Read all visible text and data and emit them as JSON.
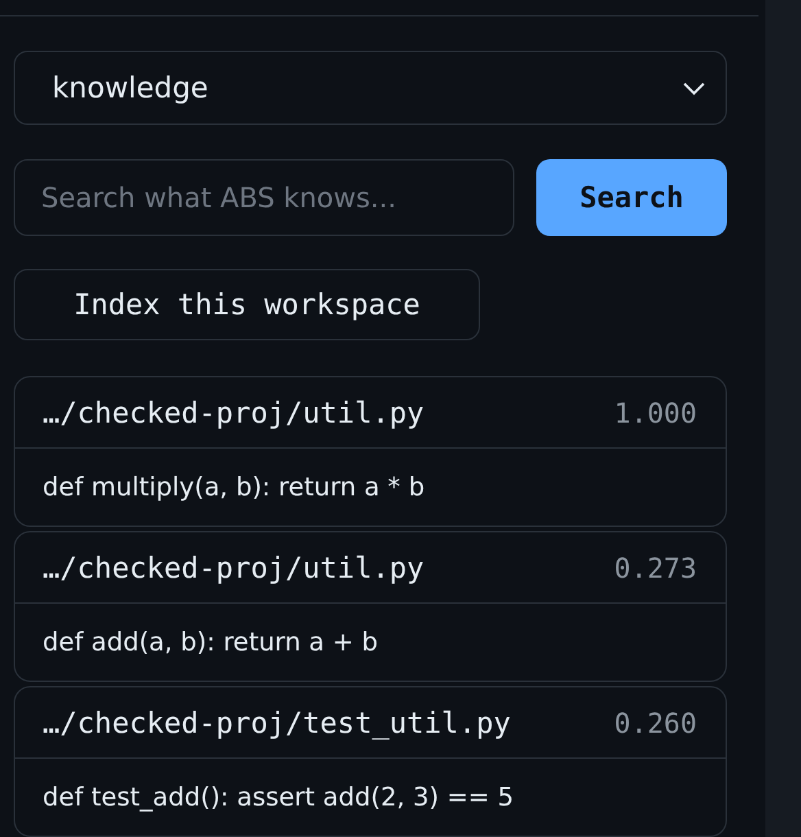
{
  "scope_select": {
    "value": "knowledge"
  },
  "search": {
    "placeholder": "Search what ABS knows...",
    "button": "Search"
  },
  "index_button": "Index this workspace",
  "results": [
    {
      "path": "…/checked-proj/util.py",
      "score": "1.000",
      "snippet": "def multiply(a, b): return a * b"
    },
    {
      "path": "…/checked-proj/util.py",
      "score": "0.273",
      "snippet": "def add(a, b): return a + b"
    },
    {
      "path": "…/checked-proj/test_util.py",
      "score": "0.260",
      "snippet": "def test_add(): assert add(2, 3) == 5"
    }
  ]
}
